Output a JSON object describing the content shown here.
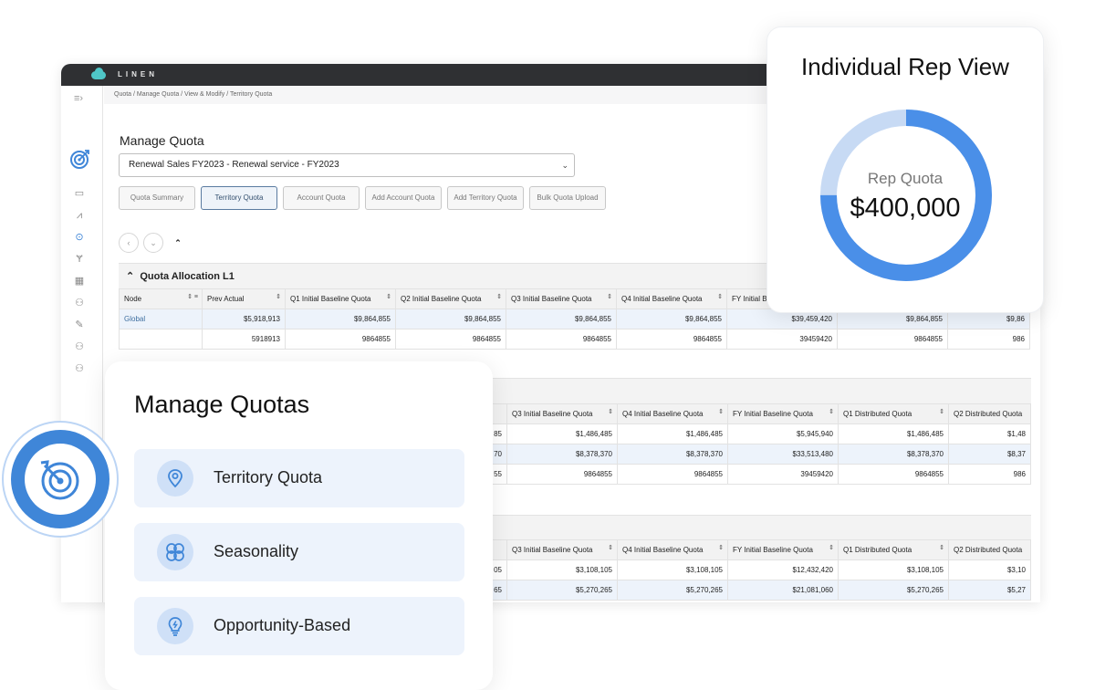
{
  "app": {
    "logo_text": "LINEN",
    "breadcrumb": "Quota / Manage Quota / View & Modify / Territory Quota",
    "page_title": "Manage Quota",
    "plan_select": "Renewal Sales FY2023 - Renewal service - FY2023",
    "buttons": [
      {
        "label": "Quota Summary",
        "active": false
      },
      {
        "label": "Territory Quota",
        "active": true
      },
      {
        "label": "Account Quota",
        "active": false
      },
      {
        "label": "Add Account Quota",
        "active": false
      },
      {
        "label": "Add Territory Quota",
        "active": false
      },
      {
        "label": "Bulk Quota Upload",
        "active": false
      }
    ],
    "section1": {
      "title": "Quota Allocation L1",
      "headers": [
        "Node",
        "Prev Actual",
        "Q1 Initial Baseline Quota",
        "Q2 Initial Baseline Quota",
        "Q3 Initial Baseline Quota",
        "Q4 Initial Baseline Quota",
        "FY Initial Ba",
        "",
        ""
      ],
      "rows": [
        [
          "Global",
          "$5,918,913",
          "$9,864,855",
          "$9,864,855",
          "$9,864,855",
          "$9,864,855",
          "$39,459,420",
          "$9,864,855",
          "$9,86"
        ],
        [
          "",
          "5918913",
          "9864855",
          "9864855",
          "9864855",
          "9864855",
          "39459420",
          "9864855",
          "986"
        ]
      ]
    },
    "section2": {
      "headers": [
        "",
        "Q3 Initial Baseline Quota",
        "Q4 Initial Baseline Quota",
        "FY Initial Baseline Quota",
        "Q1 Distributed Quota",
        "Q2 Distributed Quota"
      ],
      "rows": [
        [
          "85",
          "$1,486,485",
          "$1,486,485",
          "$5,945,940",
          "$1,486,485",
          "$1,48"
        ],
        [
          "70",
          "$8,378,370",
          "$8,378,370",
          "$33,513,480",
          "$8,378,370",
          "$8,37"
        ],
        [
          "55",
          "9864855",
          "9864855",
          "39459420",
          "9864855",
          "986"
        ]
      ]
    },
    "section3": {
      "headers": [
        "",
        "Q3 Initial Baseline Quota",
        "Q4 Initial Baseline Quota",
        "FY Initial Baseline Quota",
        "Q1 Distributed Quota",
        "Q2 Distributed Quota"
      ],
      "rows": [
        [
          "05",
          "$3,108,105",
          "$3,108,105",
          "$12,432,420",
          "$3,108,105",
          "$3,10"
        ],
        [
          "65",
          "$5,270,265",
          "$5,270,265",
          "$21,081,060",
          "$5,270,265",
          "$5,27"
        ]
      ]
    }
  },
  "rep_view": {
    "title": "Individual Rep View",
    "label": "Rep Quota",
    "value": "$400,000",
    "progress_fraction": 0.75,
    "colors": {
      "fill": "#4a8fe8",
      "track": "#c7daf4"
    }
  },
  "manage_quotas": {
    "title": "Manage Quotas",
    "items": [
      {
        "label": "Territory Quota",
        "icon": "location-pin-icon"
      },
      {
        "label": "Seasonality",
        "icon": "seasonality-icon"
      },
      {
        "label": "Opportunity-Based",
        "icon": "lightbulb-icon"
      }
    ]
  }
}
